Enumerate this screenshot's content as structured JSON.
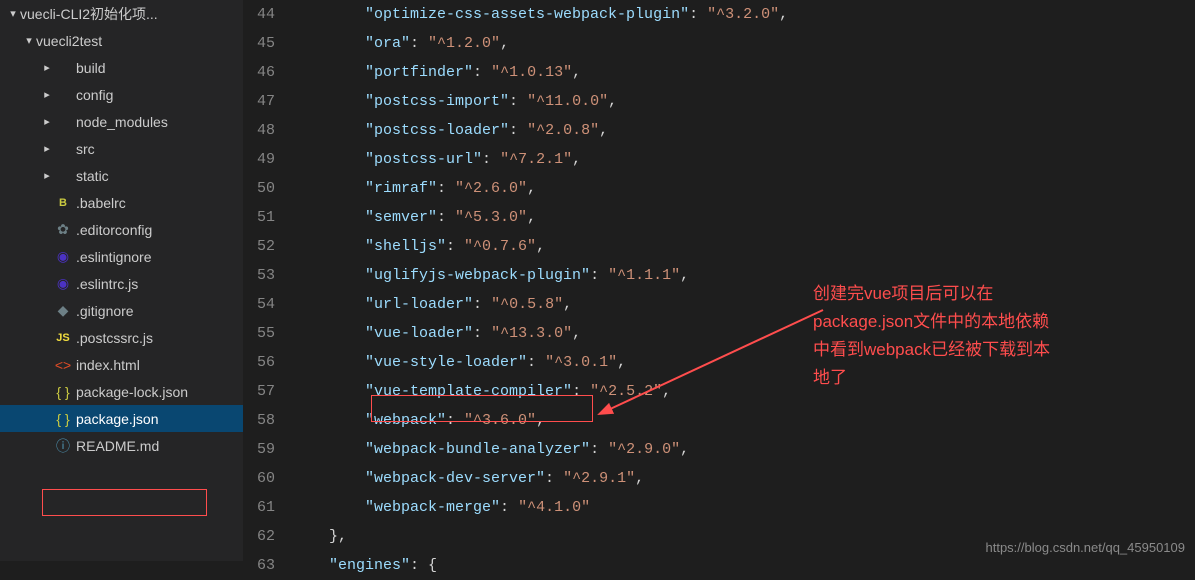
{
  "sidebar": {
    "root": "vuecli-CLI2初始化项...",
    "project": "vuecli2test",
    "items": [
      {
        "label": "build",
        "type": "folder"
      },
      {
        "label": "config",
        "type": "folder"
      },
      {
        "label": "node_modules",
        "type": "folder"
      },
      {
        "label": "src",
        "type": "folder"
      },
      {
        "label": "static",
        "type": "folder"
      },
      {
        "label": ".babelrc",
        "type": "babel"
      },
      {
        "label": ".editorconfig",
        "type": "gear"
      },
      {
        "label": ".eslintignore",
        "type": "eslint"
      },
      {
        "label": ".eslintrc.js",
        "type": "eslint"
      },
      {
        "label": ".gitignore",
        "type": "git"
      },
      {
        "label": ".postcssrc.js",
        "type": "js"
      },
      {
        "label": "index.html",
        "type": "html"
      },
      {
        "label": "package-lock.json",
        "type": "json"
      },
      {
        "label": "package.json",
        "type": "json",
        "selected": true
      },
      {
        "label": "README.md",
        "type": "info"
      }
    ]
  },
  "editor": {
    "startLine": 44,
    "entries": [
      {
        "key": "optimize-css-assets-webpack-plugin",
        "val": "^3.2.0"
      },
      {
        "key": "ora",
        "val": "^1.2.0"
      },
      {
        "key": "portfinder",
        "val": "^1.0.13"
      },
      {
        "key": "postcss-import",
        "val": "^11.0.0"
      },
      {
        "key": "postcss-loader",
        "val": "^2.0.8"
      },
      {
        "key": "postcss-url",
        "val": "^7.2.1"
      },
      {
        "key": "rimraf",
        "val": "^2.6.0"
      },
      {
        "key": "semver",
        "val": "^5.3.0"
      },
      {
        "key": "shelljs",
        "val": "^0.7.6"
      },
      {
        "key": "uglifyjs-webpack-plugin",
        "val": "^1.1.1"
      },
      {
        "key": "url-loader",
        "val": "^0.5.8"
      },
      {
        "key": "vue-loader",
        "val": "^13.3.0"
      },
      {
        "key": "vue-style-loader",
        "val": "^3.0.1"
      },
      {
        "key": "vue-template-compiler",
        "val": "^2.5.2"
      },
      {
        "key": "webpack",
        "val": "^3.6.0"
      },
      {
        "key": "webpack-bundle-analyzer",
        "val": "^2.9.0"
      },
      {
        "key": "webpack-dev-server",
        "val": "^2.9.1"
      },
      {
        "key": "webpack-merge",
        "val": "^4.1.0"
      }
    ],
    "closeBrace": "},",
    "enginesKey": "engines",
    "enginesOpen": ": {"
  },
  "annotation": {
    "line1": "创建完vue项目后可以在",
    "line2": "package.json文件中的本地依赖",
    "line3": "中看到webpack已经被下载到本",
    "line4": "地了"
  },
  "watermark": "https://blog.csdn.net/qq_45950109"
}
